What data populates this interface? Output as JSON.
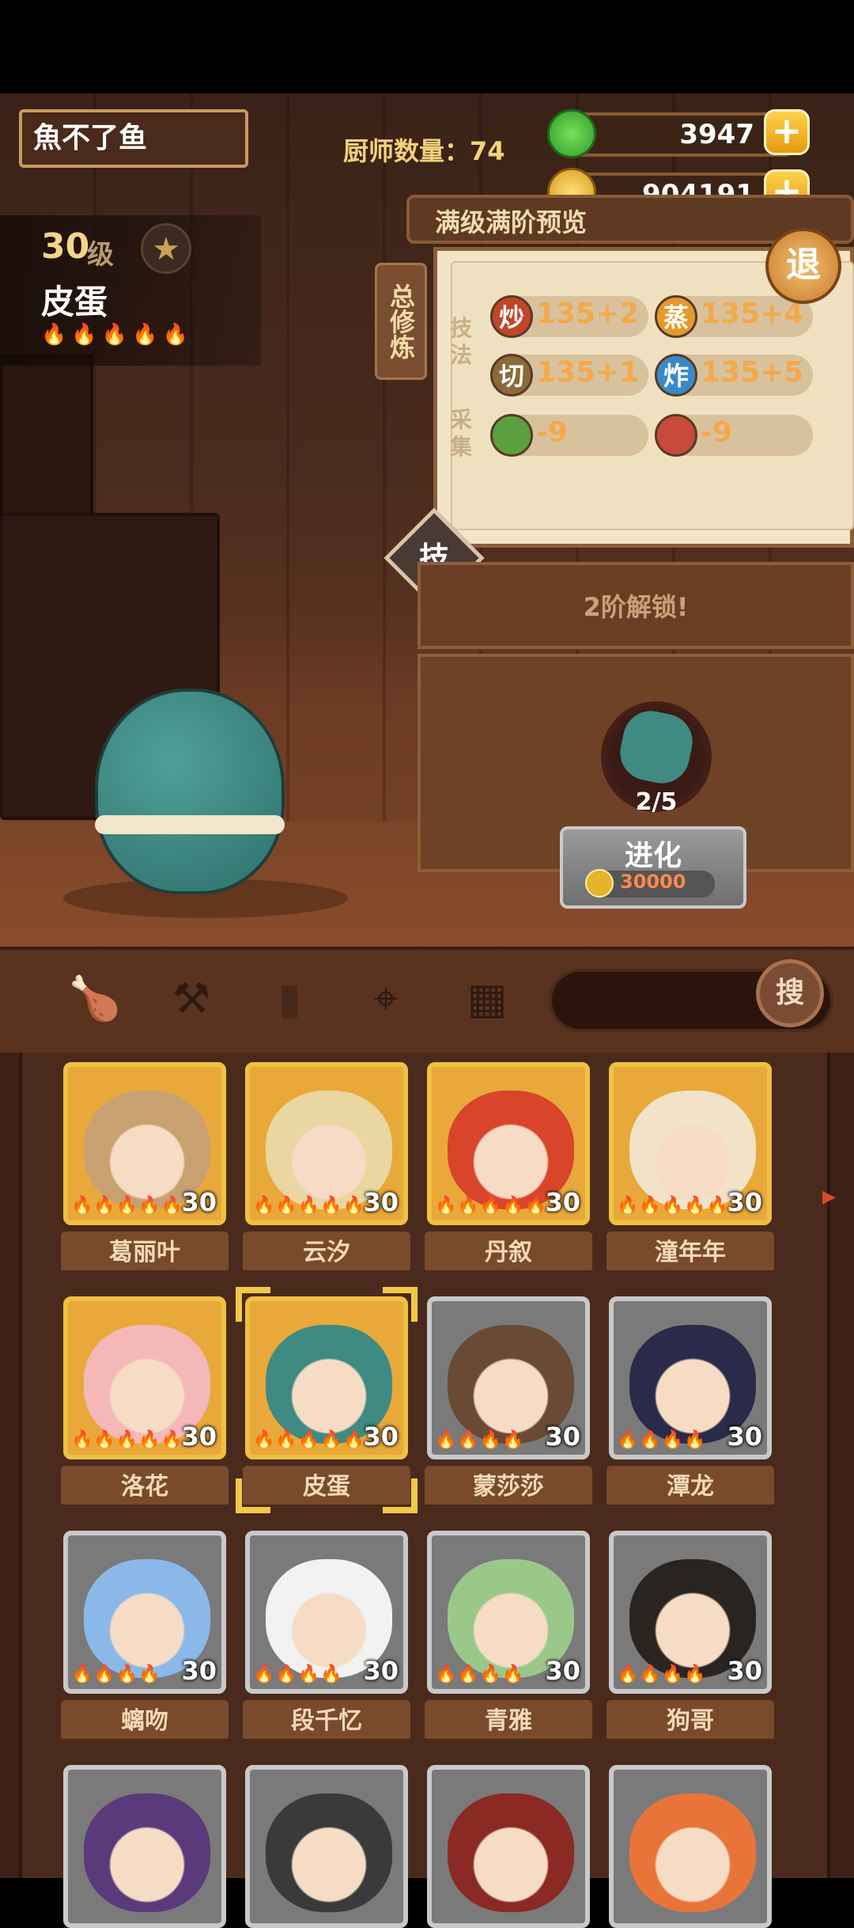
{
  "player": {
    "name": "魚不了鱼"
  },
  "chef_count": "厨师数量：74",
  "resources": {
    "jade": {
      "value": "3947",
      "icon": "green-jade-icon"
    },
    "coins": {
      "value": "904191",
      "icon": "coin-icon"
    },
    "plus": "+"
  },
  "chef": {
    "level_num": "30",
    "level_unit": "级",
    "name": "皮蛋",
    "rarity_flames": "🔥🔥🔥🔥🔥"
  },
  "preview": {
    "title": "满级满阶预览",
    "side_tab": "总修炼",
    "section_skill": "技法",
    "section_gather": "采集",
    "stats": [
      {
        "icon": "炒",
        "value": "135+2",
        "color": "#c0462a"
      },
      {
        "icon": "蒸",
        "value": "135+4",
        "color": "#e39a2a"
      },
      {
        "icon": "切",
        "value": "135+1",
        "color": "#8a6a3a"
      },
      {
        "icon": "炸",
        "value": "135+5",
        "color": "#3a8ac8"
      }
    ],
    "gather": [
      {
        "icon": "vegetable-icon",
        "value": "-9",
        "color": "#5aa040"
      },
      {
        "icon": "meat-icon",
        "value": "-9",
        "color": "#c84a3a"
      }
    ],
    "skill_badge": "技"
  },
  "exit_label": "退",
  "unlock_text": "2阶解锁!",
  "evolve": {
    "count": "2/5",
    "button_label": "进化",
    "cost": "30000"
  },
  "toolbar": {
    "icons": [
      "drumstick-icon",
      "shovel-icon",
      "jar-icon",
      "location-pin-icon",
      "map-icon"
    ],
    "search_label": "搜"
  },
  "chef_list": [
    {
      "name": "葛丽叶",
      "level": "30",
      "flames": "🔥🔥🔥🔥🔥",
      "tier": "gold",
      "color": "#c9a070"
    },
    {
      "name": "云汐",
      "level": "30",
      "flames": "🔥🔥🔥🔥🔥",
      "tier": "gold",
      "color": "#e9d6a0"
    },
    {
      "name": "丹叙",
      "level": "30",
      "flames": "🔥🔥🔥🔥🔥",
      "tier": "gold",
      "color": "#d8452a"
    },
    {
      "name": "潼年年",
      "level": "30",
      "flames": "🔥🔥🔥🔥🔥",
      "tier": "gold",
      "color": "#f1e2c8"
    },
    {
      "name": "洛花",
      "level": "30",
      "flames": "🔥🔥🔥🔥🔥",
      "tier": "gold",
      "color": "#f4b8b8"
    },
    {
      "name": "皮蛋",
      "level": "30",
      "flames": "🔥🔥🔥🔥🔥",
      "tier": "gold",
      "color": "#3f8a82",
      "selected": true
    },
    {
      "name": "蒙莎莎",
      "level": "30",
      "flames": "🔥🔥🔥🔥",
      "tier": "silver",
      "color": "#6a4a34"
    },
    {
      "name": "潭龙",
      "level": "30",
      "flames": "🔥🔥🔥🔥",
      "tier": "silver",
      "color": "#2a2a4a"
    },
    {
      "name": "螭吻",
      "level": "30",
      "flames": "🔥🔥🔥🔥",
      "tier": "silver",
      "color": "#8ab8e8"
    },
    {
      "name": "段千忆",
      "level": "30",
      "flames": "🔥🔥🔥🔥",
      "tier": "silver",
      "color": "#f2f2f2"
    },
    {
      "name": "青雅",
      "level": "30",
      "flames": "🔥🔥🔥🔥",
      "tier": "silver",
      "color": "#9ac88a"
    },
    {
      "name": "狗哥",
      "level": "30",
      "flames": "🔥🔥🔥🔥",
      "tier": "silver",
      "color": "#2a2420"
    },
    {
      "name": "",
      "level": "",
      "flames": "",
      "tier": "silver",
      "color": "#5a3a7a"
    },
    {
      "name": "",
      "level": "",
      "flames": "",
      "tier": "silver",
      "color": "#3a3a3a"
    },
    {
      "name": "",
      "level": "",
      "flames": "",
      "tier": "silver",
      "color": "#8a2a22"
    },
    {
      "name": "",
      "level": "",
      "flames": "",
      "tier": "silver",
      "color": "#e8743a"
    }
  ]
}
